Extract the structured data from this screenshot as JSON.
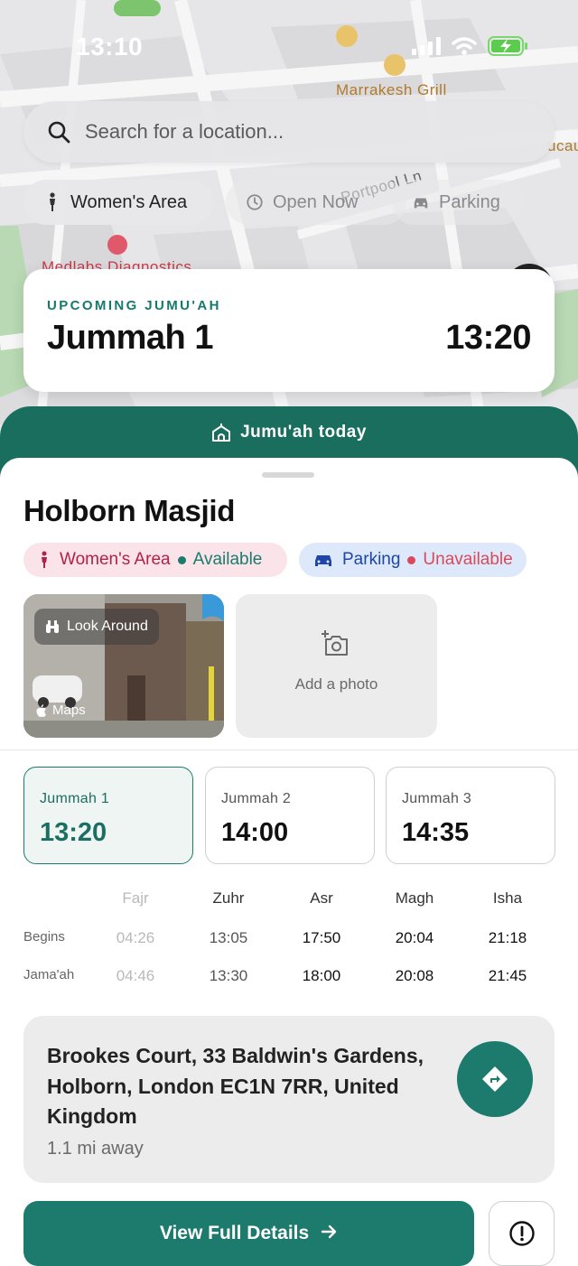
{
  "status_bar": {
    "time": "13:10"
  },
  "map": {
    "labels": [
      "Marrakesh Grill",
      "Portpool Ln",
      "Medlabs Diagnostics",
      "ucau"
    ]
  },
  "search": {
    "placeholder": "Search for a location..."
  },
  "filters": [
    {
      "label": "Women's Area",
      "icon": "person-icon",
      "active": true
    },
    {
      "label": "Open Now",
      "icon": "clock-icon",
      "active": false
    },
    {
      "label": "Parking",
      "icon": "car-icon",
      "active": false
    }
  ],
  "upcoming": {
    "eyebrow": "UPCOMING JUMU'AH",
    "name": "Jummah 1",
    "time": "13:20"
  },
  "banner": {
    "label": "Jumu'ah today",
    "icon": "mosque-icon"
  },
  "masjid": {
    "name": "Holborn Masjid",
    "amenities": {
      "women": {
        "label": "Women's Area",
        "status": "Available"
      },
      "parking": {
        "label": "Parking",
        "status": "Unavailable"
      }
    },
    "photo": {
      "look_around": "Look Around",
      "maps": "Maps"
    },
    "add_photo": "Add a photo"
  },
  "jummah_times": [
    {
      "label": "Jummah 1",
      "time": "13:20",
      "selected": true
    },
    {
      "label": "Jummah 2",
      "time": "14:00",
      "selected": false
    },
    {
      "label": "Jummah 3",
      "time": "14:35",
      "selected": false
    }
  ],
  "prayer_table": {
    "columns": [
      "Fajr",
      "Zuhr",
      "Asr",
      "Magh",
      "Isha"
    ],
    "rows": [
      {
        "label": "Begins",
        "values": [
          "04:26",
          "13:05",
          "17:50",
          "20:04",
          "21:18"
        ]
      },
      {
        "label": "Jama'ah",
        "values": [
          "04:46",
          "13:30",
          "18:00",
          "20:08",
          "21:45"
        ]
      }
    ]
  },
  "address": {
    "text": "Brookes Court, 33 Baldwin's Gardens, Holborn, London EC1N 7RR, United Kingdom",
    "distance": "1.1 mi away"
  },
  "actions": {
    "view_details": "View Full Details"
  },
  "colors": {
    "brand": "#1c7b6d",
    "banner": "#196e5e",
    "women_bg": "#fbe3ea",
    "parking_bg": "#dde9fb"
  }
}
